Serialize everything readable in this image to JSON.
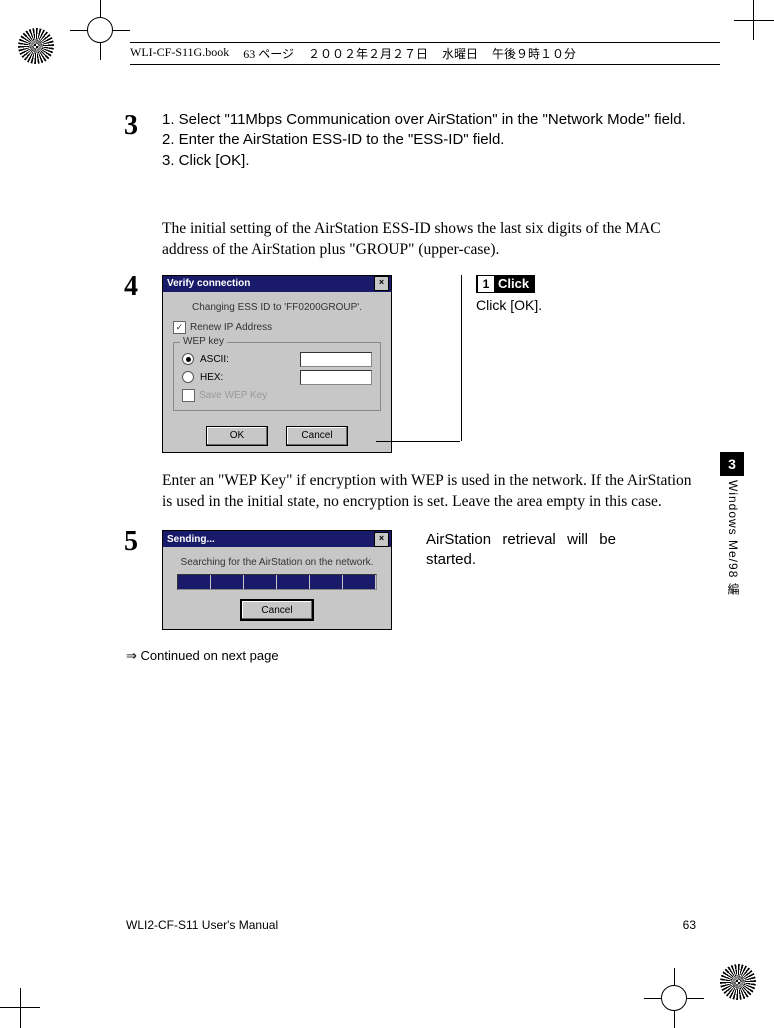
{
  "header": {
    "book": "WLI-CF-S11G.book",
    "page_label": "63 ページ",
    "date": "２００２年２月２７日",
    "weekday": "水曜日",
    "time": "午後９時１０分"
  },
  "side": {
    "chapter_num": "3",
    "chapter_label": "Windows Me/98 編"
  },
  "steps": {
    "s3": {
      "num": "3",
      "line1": "1. Select \"11Mbps Communication over AirStation\" in the \"Network Mode\" field.",
      "line2": "2. Enter the AirStation ESS-ID to the \"ESS-ID\" field.",
      "line3": "3. Click [OK]."
    },
    "note3": "The initial setting of the AirStation ESS-ID shows the last six digits of the MAC address of the AirStation plus \"GROUP\" (upper-case).",
    "s4": {
      "num": "4",
      "dlg_title": "Verify connection",
      "changing": "Changing ESS ID to 'FF0200GROUP'.",
      "renew": "Renew IP Address",
      "grouplabel": "WEP key",
      "ascii": "ASCII:",
      "hex": "HEX:",
      "savekey": "Save WEP Key",
      "ok": "OK",
      "cancel": "Cancel",
      "click_badge": "Click",
      "click_label": "Click [OK]."
    },
    "note4": "Enter an \"WEP Key\" if encryption with WEP is used in the network.  If the AirStation is used in the initial state, no encryption is set.  Leave the area empty in this case.",
    "s5": {
      "num": "5",
      "dlg_title": "Sending...",
      "searching": "Searching for the AirStation on the network.",
      "cancel": "Cancel",
      "retrieval": "AirStation retrieval will be started."
    },
    "continued": "⇒ Continued on next page"
  },
  "footer": {
    "manual": "WLI2-CF-S11 User's Manual",
    "pagenum": "63"
  }
}
